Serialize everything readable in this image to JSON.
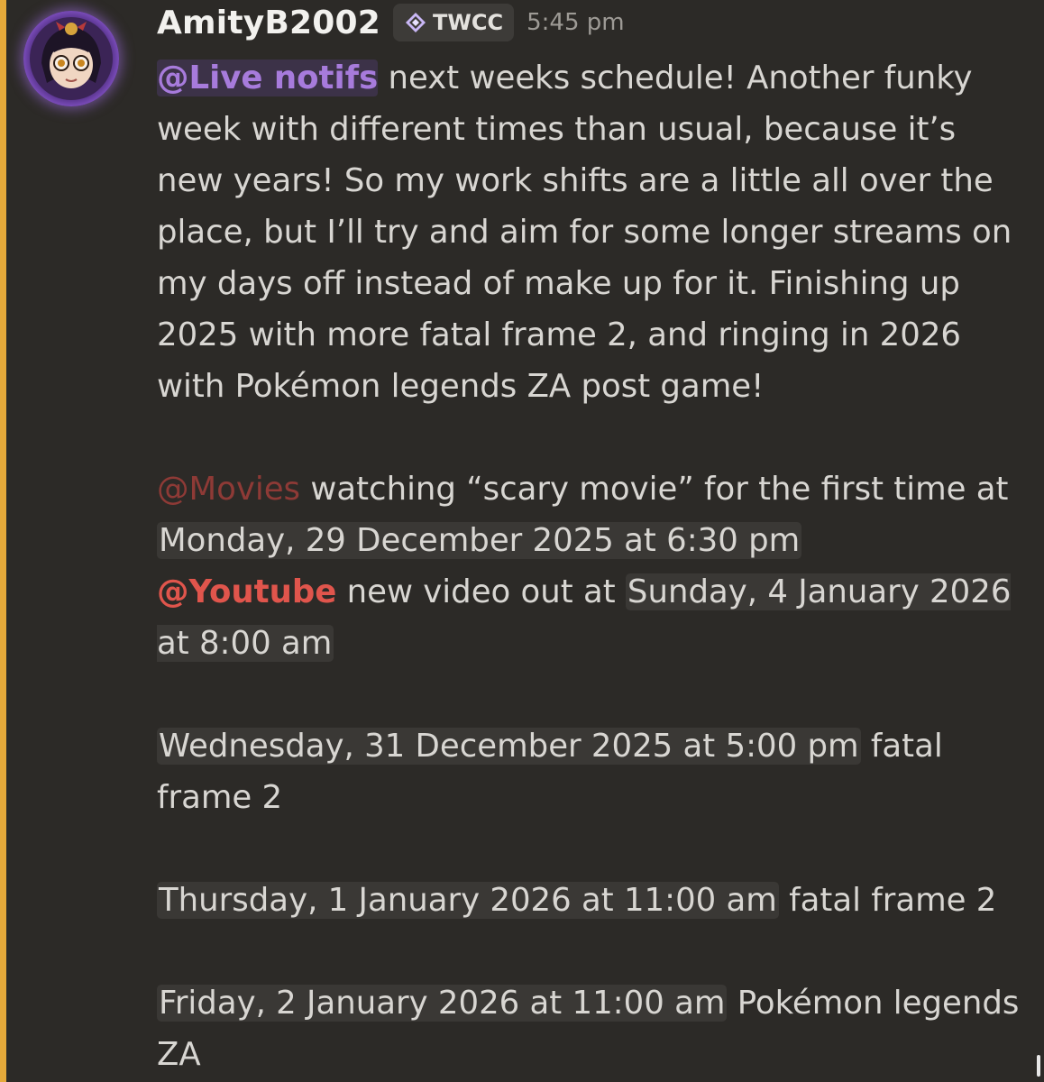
{
  "message": {
    "username": "AmityB2002",
    "tag": "TWCC",
    "time": "5:45 pm",
    "p1_mention": "@Live notifs",
    "p1_text": " next weeks schedule! Another funky week with different times than usual, because it’s new years! So my work shifts are a little all over the place, but I’ll try and aim for some longer streams on my days off instead of make up for it. Finishing up 2025 with more fatal frame 2, and ringing in 2026 with Pokémon legends ZA post game!",
    "movies_mention": "@Movies",
    "movies_text": " watching “scary movie” for the first time at ",
    "movies_time": "Monday, 29 December 2025 at 6:30 pm",
    "youtube_mention": "@Youtube",
    "youtube_text": " new video out at ",
    "youtube_time": "Sunday, 4 January 2026 at 8:00 am",
    "s1_time": "Wednesday, 31 December 2025 at 5:00 pm",
    "s1_text": " fatal frame 2",
    "s2_time": "Thursday, 1 January 2026 at 11:00 am",
    "s2_text": " fatal frame 2",
    "s3_time": "Friday, 2 January 2026 at 11:00 am",
    "s3_text": " Pokémon legends ZA"
  },
  "icons": {
    "avatar": "user-avatar",
    "tag": "diamond-sparkle-icon"
  },
  "colors": {
    "background": "#2c2a27",
    "accent_bar": "#e5a93a",
    "mention_live": "#a77bdc",
    "mention_movies": "#8e3a36",
    "mention_youtube": "#e0554c"
  }
}
